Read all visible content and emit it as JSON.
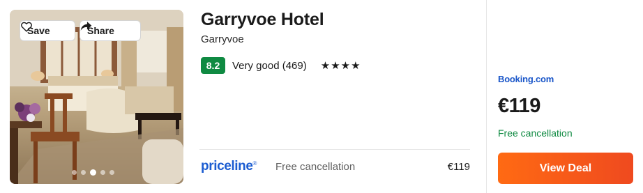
{
  "photo": {
    "save_label": "Save",
    "share_label": "Share",
    "carousel": {
      "total": 5,
      "active_index": 2
    }
  },
  "hotel": {
    "name": "Garryvoe Hotel",
    "location": "Garryvoe",
    "score": "8.2",
    "rating_text": "Very good (469)",
    "stars": "★★★★"
  },
  "offer": {
    "provider_logo": "priceline",
    "cancellation": "Free cancellation",
    "price": "€119"
  },
  "deal": {
    "provider_logo": "Booking.com",
    "price": "€119",
    "cancellation": "Free cancellation",
    "button_label": "View Deal"
  },
  "colors": {
    "score_badge": "#0f8a42",
    "free_cancellation": "#0f8a42",
    "priceline_blue": "#1b5cd1",
    "booking_blue": "#1a56c9",
    "deal_button": "#ff6a13"
  }
}
